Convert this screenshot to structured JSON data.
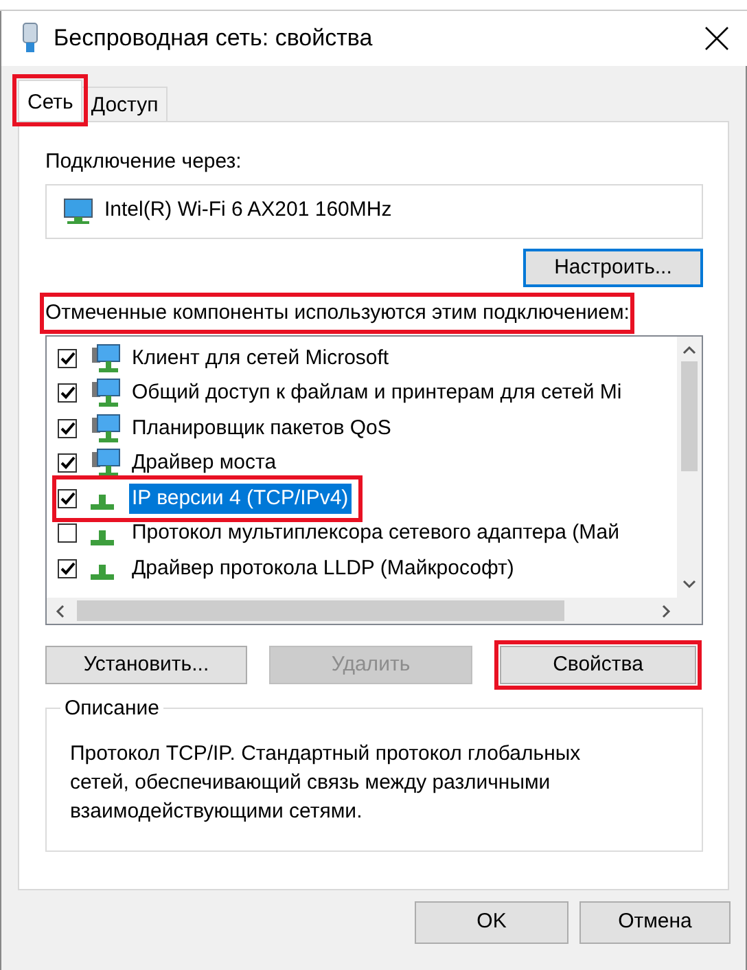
{
  "window": {
    "title": "Беспроводная сеть: свойства"
  },
  "tabs": [
    {
      "label": "Сеть",
      "selected": true,
      "highlighted": true
    },
    {
      "label": "Доступ",
      "selected": false,
      "highlighted": false
    }
  ],
  "connect_via": {
    "label": "Подключение через:",
    "adapter": "Intel(R) Wi-Fi 6 AX201 160MHz"
  },
  "configure_button": "Настроить...",
  "components_label": {
    "text": "Отмеченные компоненты используются этим подключением:",
    "highlighted": true
  },
  "components": [
    {
      "kind": "service",
      "label": "Клиент для сетей Microsoft",
      "checked": true,
      "selected": false,
      "highlighted": false
    },
    {
      "kind": "service",
      "label": "Общий доступ к файлам и принтерам для сетей Mi",
      "checked": true,
      "selected": false,
      "highlighted": false
    },
    {
      "kind": "service",
      "label": "Планировщик пакетов QoS",
      "checked": true,
      "selected": false,
      "highlighted": false
    },
    {
      "kind": "service",
      "label": "Драйвер моста",
      "checked": true,
      "selected": false,
      "highlighted": false
    },
    {
      "kind": "protocol",
      "label": "IP версии 4 (TCP/IPv4)",
      "checked": true,
      "selected": true,
      "highlighted": true
    },
    {
      "kind": "protocol",
      "label": "Протокол мультиплексора сетевого адаптера (Май",
      "checked": false,
      "selected": false,
      "highlighted": false
    },
    {
      "kind": "protocol",
      "label": "Драйвер протокола LLDP (Майкрософт)",
      "checked": true,
      "selected": false,
      "highlighted": false
    }
  ],
  "action_buttons": [
    {
      "label": "Установить...",
      "disabled": false,
      "highlighted": false
    },
    {
      "label": "Удалить",
      "disabled": true,
      "highlighted": false
    },
    {
      "label": "Свойства",
      "disabled": false,
      "highlighted": true
    }
  ],
  "description": {
    "title": "Описание",
    "text": "Протокол TCP/IP. Стандартный протокол глобальных сетей, обеспечивающий связь между различными взаимодействующими сетями."
  },
  "footer_buttons": [
    "OK",
    "Отмена"
  ]
}
